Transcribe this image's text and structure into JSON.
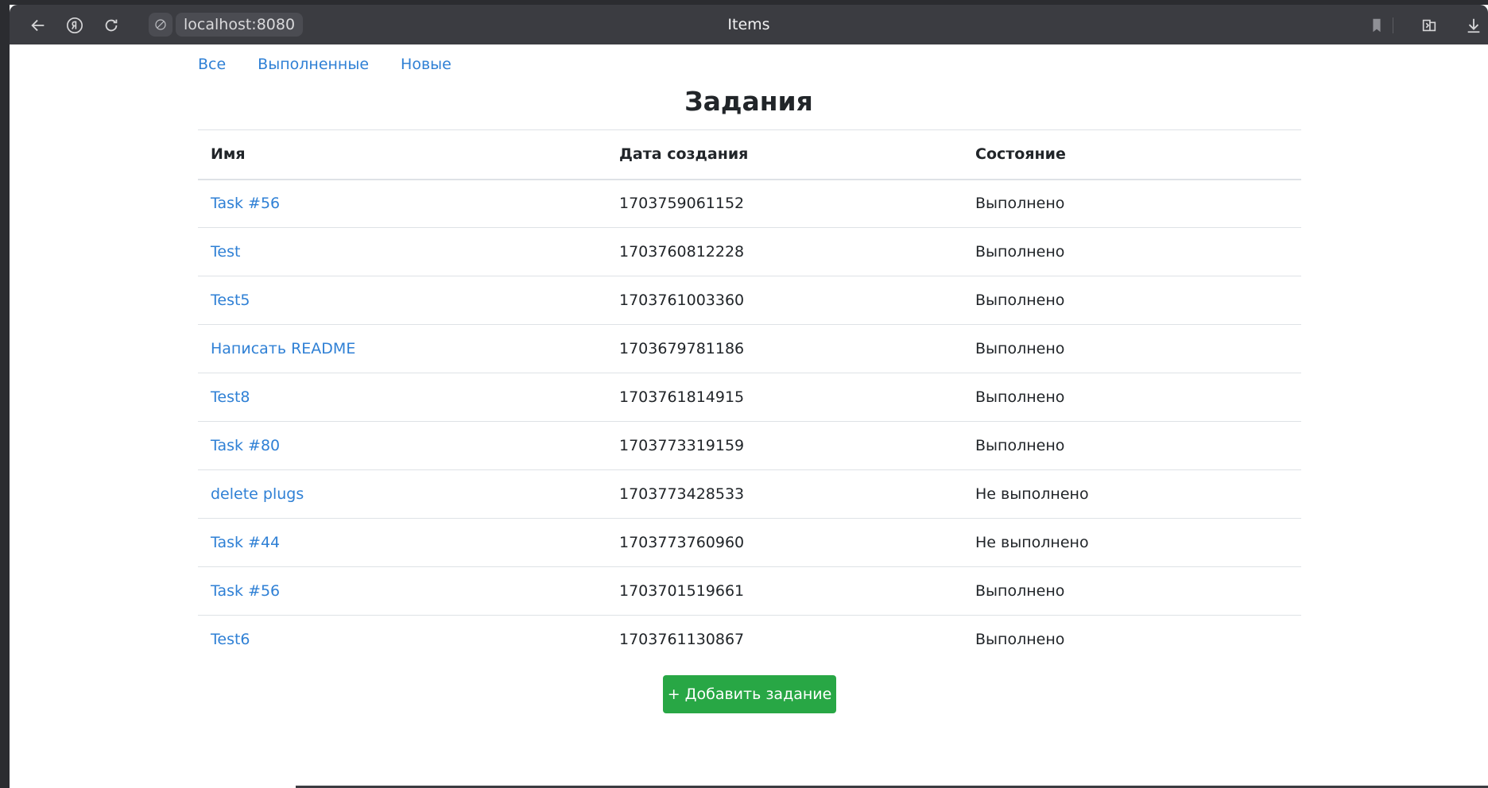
{
  "browser": {
    "url": "localhost:8080",
    "window_title": "Items"
  },
  "nav": {
    "links": [
      "Все",
      "Выполненные",
      "Новые"
    ]
  },
  "page": {
    "title": "Задания"
  },
  "table": {
    "headers": [
      "Имя",
      "Дата создания",
      "Состояние"
    ],
    "rows": [
      {
        "name": "Task #56",
        "date": "1703759061152",
        "status": "Выполнено"
      },
      {
        "name": "Test",
        "date": "1703760812228",
        "status": "Выполнено"
      },
      {
        "name": "Test5",
        "date": "1703761003360",
        "status": "Выполнено"
      },
      {
        "name": "Написать README",
        "date": "1703679781186",
        "status": "Выполнено"
      },
      {
        "name": "Test8",
        "date": "1703761814915",
        "status": "Выполнено"
      },
      {
        "name": "Task #80",
        "date": "1703773319159",
        "status": "Выполнено"
      },
      {
        "name": "delete plugs",
        "date": "1703773428533",
        "status": "Не выполнено"
      },
      {
        "name": "Task #44",
        "date": "1703773760960",
        "status": "Не выполнено"
      },
      {
        "name": "Task #56",
        "date": "1703701519661",
        "status": "Выполнено"
      },
      {
        "name": "Test6",
        "date": "1703761130867",
        "status": "Выполнено"
      }
    ]
  },
  "actions": {
    "add_label": "+ Добавить задание"
  },
  "colors": {
    "link": "#2f80d5",
    "success": "#28a745",
    "toolbar": "#3b3c41"
  }
}
